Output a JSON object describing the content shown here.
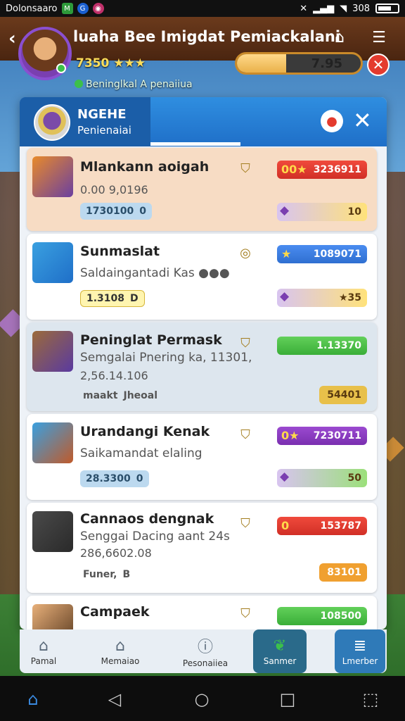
{
  "status_bar": {
    "left_text": "Dolonsaaro",
    "right_text": "308"
  },
  "header": {
    "title": "luaha Bee Imigdat Pemiackalani",
    "level_stats": "7350 ★★★",
    "subtitle": "Beninglkal A penaiiua",
    "progress_value": "7.95",
    "progress_fraction": 0.4
  },
  "modal": {
    "profile_name": "NGEHE",
    "profile_sub": "Penienaiai"
  },
  "items": [
    {
      "title": "Mlankann aoigah",
      "subtitle": "",
      "number": "0.00 9,0196",
      "chip": "1730100",
      "chip_tail": "0",
      "badge": "3236911",
      "badge_lead": "00★",
      "reward": "10"
    },
    {
      "title": "Sunmaslat",
      "subtitle": "Saldaingantadi Kas ●●●",
      "number": "",
      "chip": "1.3108",
      "chip_tail": "D",
      "badge": "1089071",
      "badge_lead": "★",
      "reward": "★35"
    },
    {
      "title": "Peninglat Permask",
      "subtitle": "Semgalai Pnering ka, 11301,",
      "number": "2,56.14.106",
      "chip": "maakt",
      "chip_tail": "Jheoal",
      "badge": "1.13370",
      "badge_lead": "",
      "reward": "54401"
    },
    {
      "title": "Urandangi Kenak",
      "subtitle": "Saikamandat elaling",
      "number": "",
      "chip": "28.3300",
      "chip_tail": "0",
      "badge": "7230711",
      "badge_lead": "0★",
      "reward": "50"
    },
    {
      "title": "Cannaos dengnak",
      "subtitle": "Senggai Dacing aant 24s",
      "number": "286,6602.08",
      "chip": "Funer,",
      "chip_tail": "B",
      "badge": "153787",
      "badge_lead": "0",
      "reward": "83101"
    },
    {
      "title": "Campaek",
      "subtitle": "",
      "number": "",
      "chip": "",
      "chip_tail": "",
      "badge": "108500",
      "badge_lead": "",
      "reward": ""
    }
  ],
  "tabs": [
    {
      "label": "Pamal"
    },
    {
      "label": "Memaiao"
    },
    {
      "label": "Pesonaiiea"
    },
    {
      "label": "Sanmer"
    },
    {
      "label": "Lmerber"
    }
  ]
}
